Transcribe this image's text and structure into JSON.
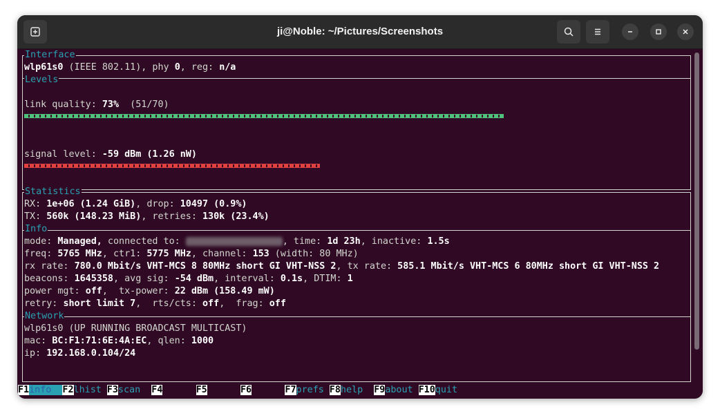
{
  "window": {
    "title": "ji@Noble: ~/Pictures/Screenshots",
    "buttons": {
      "new_tab_icon": "new-tab-icon",
      "search_icon": "search-icon",
      "menu_icon": "hamburger-menu-icon",
      "minimize_icon": "minimize-icon",
      "maximize_icon": "maximize-icon",
      "close_icon": "close-icon"
    }
  },
  "sections": {
    "interface": {
      "title": "Interface",
      "iface": "wlp61s0",
      "standard": " (IEEE 802.11), phy ",
      "phy": "0",
      "reg_label": ", reg: ",
      "reg": "n/a"
    },
    "levels": {
      "title": "Levels",
      "link_label": "link quality: ",
      "link_quality": "73%",
      "link_ratio": "  (51/70)",
      "link_bar_percent": 73,
      "signal_label": "signal level: ",
      "signal_value": "-59 dBm (1.26 nW)",
      "signal_bar_percent": 45
    },
    "statistics": {
      "title": "Statistics",
      "rx_label": "RX: ",
      "rx_value": "1e+06 (1.24 GiB)",
      "rx_drop_label": ", drop: ",
      "rx_drop": "10497 (0.9%)",
      "tx_label": "TX: ",
      "tx_value": "560k (148.23 MiB)",
      "tx_retries_label": ", retries: ",
      "tx_retries": "130k (23.4%)"
    },
    "info": {
      "title": "Info",
      "mode_label": "mode: ",
      "mode": "Managed,",
      "connected_label": " connected to: ",
      "time_label": ", time: ",
      "time": "1d 23h",
      "inactive_label": ", inactive: ",
      "inactive": "1.5s",
      "freq_label": "freq: ",
      "freq": "5765 MHz",
      "ctr1_label": ", ctr1: ",
      "ctr1": "5775 MHz",
      "channel_label": ", channel: ",
      "channel": "153",
      "width": " (width: 80 MHz)",
      "rxrate_label": "rx rate: ",
      "rxrate": "780.0 Mbit/s VHT-MCS 8 80MHz short GI VHT-NSS 2",
      "txrate_label": ", tx rate: ",
      "txrate": "585.1 Mbit/s VHT-MCS 6 80MHz short GI VHT-NSS 2",
      "beacons_label": "beacons: ",
      "beacons": "1645358",
      "avgsig_label": ", avg sig: ",
      "avgsig": "-54 dBm",
      "interval_label": ", interval: ",
      "interval": "0.1s",
      "dtim_label": ", DTIM: ",
      "dtim": "1",
      "power_label": "power mgt: ",
      "power": "off",
      "txpower_label": ",  tx-power: ",
      "txpower": "22 dBm (158.49 mW)",
      "retry_label": "retry: ",
      "retry": "short limit 7",
      "rts_label": ",  rts/cts: ",
      "rts": "off",
      "frag_label": ",  frag: ",
      "frag": "off"
    },
    "network": {
      "title": "Network",
      "iface": "wlp61s0",
      "flags": " (UP RUNNING BROADCAST MULTICAST)",
      "mac_label": "mac: ",
      "mac": "BC:F1:71:6E:4A:EC",
      "qlen_label": ", qlen: ",
      "qlen": "1000",
      "ip_label": "ip: ",
      "ip": "192.168.0.104/24"
    }
  },
  "footer": [
    {
      "key": "F1",
      "label": "info",
      "active": true
    },
    {
      "key": "F2",
      "label": "lhist"
    },
    {
      "key": "F3",
      "label": "scan"
    },
    {
      "key": "F4",
      "label": ""
    },
    {
      "key": "F5",
      "label": ""
    },
    {
      "key": "F6",
      "label": ""
    },
    {
      "key": "F7",
      "label": "prefs"
    },
    {
      "key": "F8",
      "label": "help"
    },
    {
      "key": "F9",
      "label": "about"
    },
    {
      "key": "F10",
      "label": "quit"
    }
  ],
  "colors": {
    "background": "#300a24",
    "accent": "#2aa1b3",
    "good_bar": "#4ec27a",
    "bad_bar": "#e04040"
  }
}
